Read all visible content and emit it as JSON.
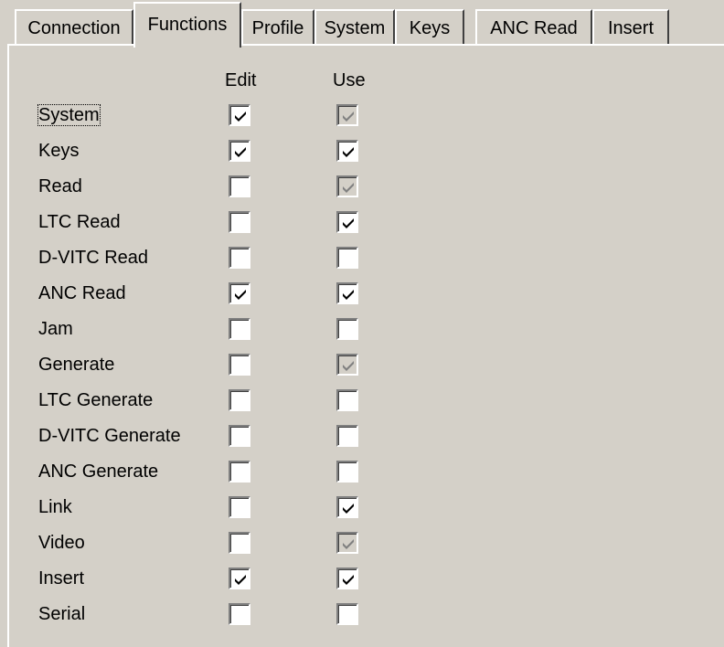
{
  "tabs": [
    {
      "label": "Connection",
      "active": false
    },
    {
      "label": "Functions",
      "active": true
    },
    {
      "label": "Profile",
      "active": false
    },
    {
      "label": "System",
      "active": false
    },
    {
      "label": "Keys",
      "active": false
    },
    {
      "label": "ANC Read",
      "active": false
    },
    {
      "label": "Insert",
      "active": false
    }
  ],
  "columns": {
    "edit": "Edit",
    "use": "Use"
  },
  "rows": [
    {
      "label": "System",
      "edit": true,
      "use": true,
      "use_disabled": true,
      "focused": true
    },
    {
      "label": "Keys",
      "edit": true,
      "use": true,
      "use_disabled": false
    },
    {
      "label": "Read",
      "edit": false,
      "use": true,
      "use_disabled": true
    },
    {
      "label": "LTC Read",
      "edit": false,
      "use": true,
      "use_disabled": false
    },
    {
      "label": "D-VITC Read",
      "edit": false,
      "use": false,
      "use_disabled": false
    },
    {
      "label": "ANC Read",
      "edit": true,
      "use": true,
      "use_disabled": false
    },
    {
      "label": "Jam",
      "edit": false,
      "use": false,
      "use_disabled": false
    },
    {
      "label": "Generate",
      "edit": false,
      "use": true,
      "use_disabled": true
    },
    {
      "label": "LTC Generate",
      "edit": false,
      "use": false,
      "use_disabled": false
    },
    {
      "label": "D-VITC Generate",
      "edit": false,
      "use": false,
      "use_disabled": false
    },
    {
      "label": "ANC Generate",
      "edit": false,
      "use": false,
      "use_disabled": false
    },
    {
      "label": "Link",
      "edit": false,
      "use": true,
      "use_disabled": false
    },
    {
      "label": "Video",
      "edit": false,
      "use": true,
      "use_disabled": true
    },
    {
      "label": "Insert",
      "edit": true,
      "use": true,
      "use_disabled": false
    },
    {
      "label": "Serial",
      "edit": false,
      "use": false,
      "use_disabled": false
    }
  ],
  "colors": {
    "face": "#d4d0c8",
    "check": "#000000",
    "check_disabled": "#808080"
  }
}
